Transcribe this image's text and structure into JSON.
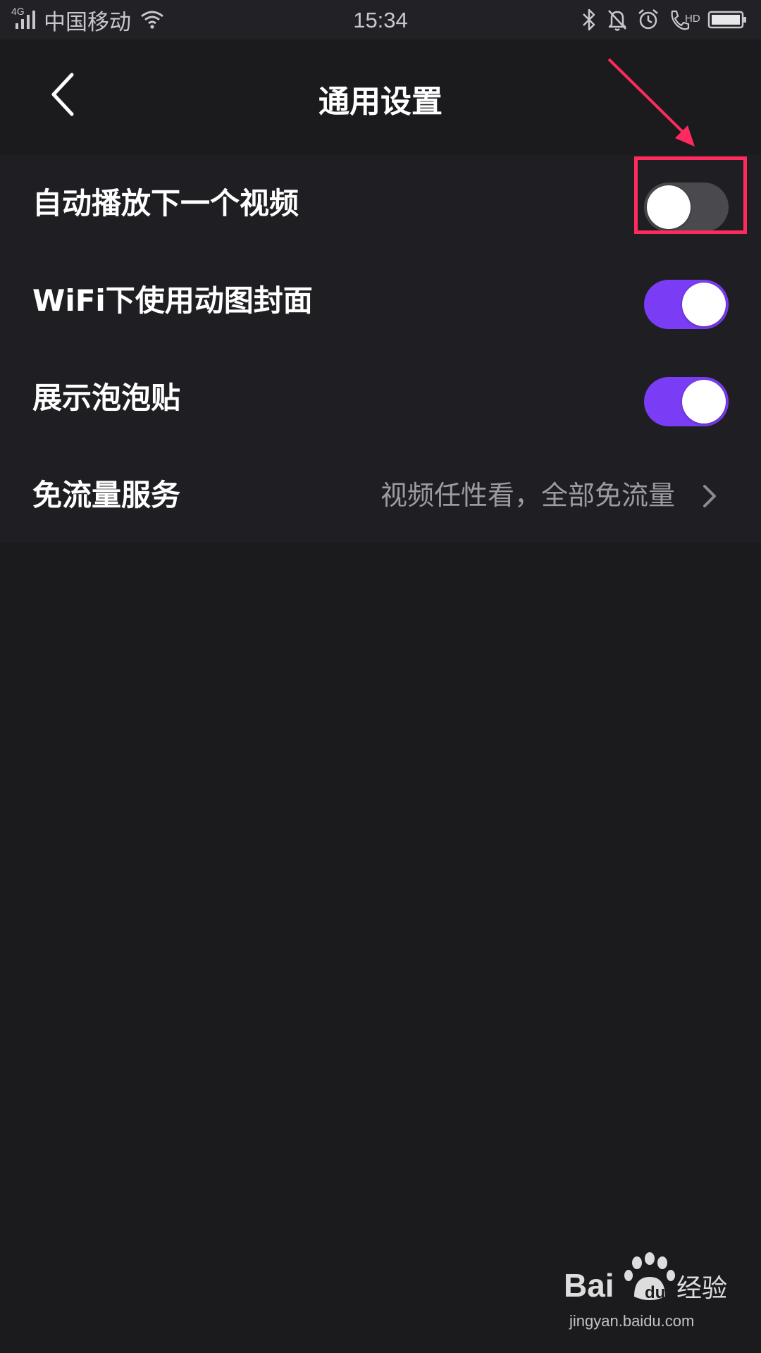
{
  "status_bar": {
    "network_gen": "4G",
    "carrier": "中国移动",
    "time": "15:34",
    "hd_label": "HD",
    "icons": [
      "signal-icon",
      "wifi-icon",
      "bluetooth-icon",
      "notification-off-icon",
      "alarm-icon",
      "call-hd-icon",
      "battery-icon"
    ]
  },
  "header": {
    "back_icon": "chevron-left-icon",
    "title": "通用设置"
  },
  "settings": [
    {
      "label": "自动播放下一个视频",
      "type": "toggle",
      "on": false
    },
    {
      "label": "WiFi下使用动图封面",
      "type": "toggle",
      "on": true
    },
    {
      "label": "展示泡泡贴",
      "type": "toggle",
      "on": true
    },
    {
      "label": "免流量服务",
      "type": "link",
      "value": "视频任性看，全部免流量",
      "icon": "chevron-right-icon"
    }
  ],
  "colors": {
    "background": "#1b1b1e",
    "list_background": "#1f1f23",
    "toggle_on": "#7b3cf5",
    "toggle_off": "#4a4a4e",
    "annotation": "#ff2a5e"
  },
  "watermark": {
    "logo_text": "Bai经验",
    "url": "jingyan.baidu.com"
  }
}
